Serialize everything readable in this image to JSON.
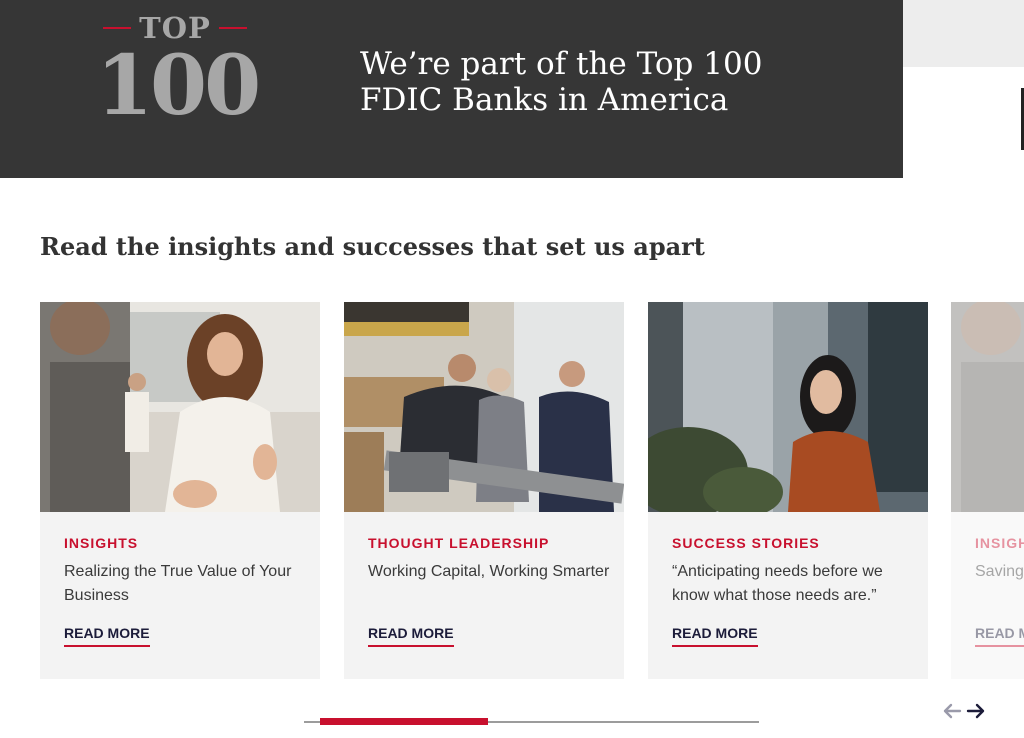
{
  "banner": {
    "logo_top": "TOP",
    "logo_number": "100",
    "headline_line1": "We’re part of the Top 100",
    "headline_line2": "FDIC Banks in America"
  },
  "section": {
    "heading": "Read the insights and successes that set us apart"
  },
  "cards": [
    {
      "category": "INSIGHTS",
      "title": "Realizing the True Value of Your Business",
      "link": "READ MORE",
      "image": "woman-smiling-office-photo"
    },
    {
      "category": "THOUGHT LEADERSHIP",
      "title": "Working Capital, Working Smarter",
      "link": "READ MORE",
      "image": "handshake-warehouse-photo"
    },
    {
      "category": "SUCCESS STORIES",
      "title": "“Anticipating needs before we know what those needs are.”",
      "link": "READ MORE",
      "image": "woman-city-buildings-photo"
    },
    {
      "category": "INSIGHTS",
      "title": "Saving",
      "link": "READ MORE",
      "image": "woman-smiling-office-photo"
    }
  ],
  "carousel": {
    "progress_fraction": 0.37,
    "prev_icon": "arrow-left-icon",
    "next_icon": "arrow-right-icon"
  },
  "colors": {
    "accent": "#c8102e",
    "banner_bg": "#363636",
    "card_bg": "#f3f3f3",
    "link_text": "#1c1c3a"
  }
}
